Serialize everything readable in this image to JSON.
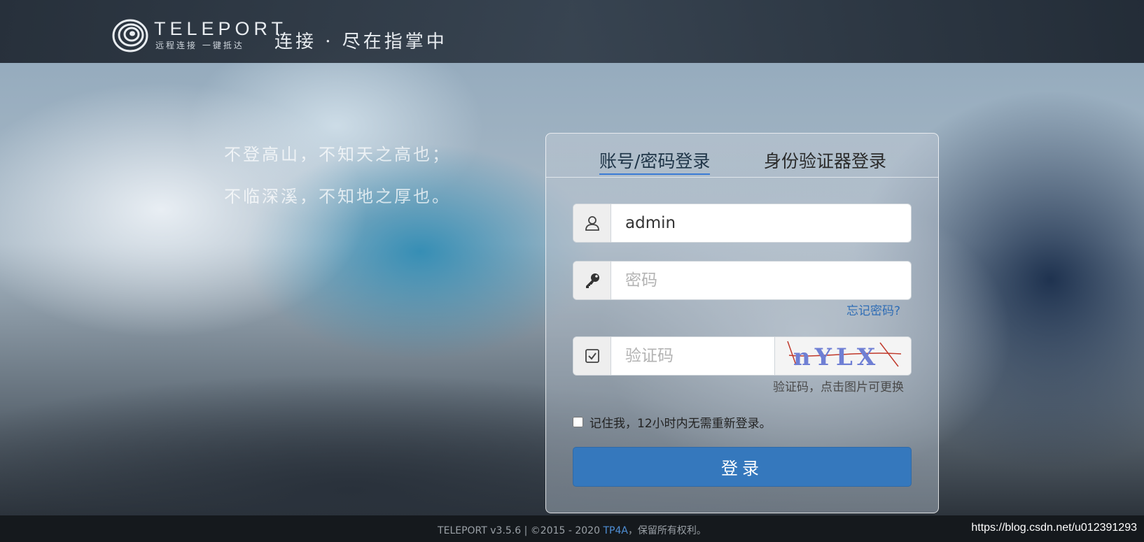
{
  "header": {
    "logo_word": "TELEPORT",
    "logo_sub": "远程连接 一键抵达",
    "slogan": "连接 · 尽在指掌中"
  },
  "poem": {
    "line1": "不登高山，不知天之高也；",
    "line2": "不临深溪，不知地之厚也。"
  },
  "login": {
    "tabs": [
      {
        "label": "账号/密码登录",
        "active": true
      },
      {
        "label": "身份验证器登录",
        "active": false
      }
    ],
    "username": {
      "value": "admin",
      "icon": "user-icon"
    },
    "password": {
      "value": "",
      "placeholder": "密码",
      "icon": "key-icon"
    },
    "forgot_label": "忘记密码?",
    "captcha": {
      "value": "",
      "placeholder": "验证码",
      "icon": "checkbox-icon",
      "image_text": "nYLX"
    },
    "captcha_hint": "验证码，点击图片可更换",
    "remember_label": "记住我，12小时内无需重新登录。",
    "remember_checked": false,
    "submit_label": "登录"
  },
  "footer": {
    "prefix": "TELEPORT v3.5.6 | ©2015 - 2020 ",
    "link": "TP4A",
    "suffix": "，保留所有权利。"
  },
  "watermark": "https://blog.csdn.net/u012391293",
  "colors": {
    "primary_button": "#3578bd",
    "link": "#2f6db5",
    "header_bg": "#1e2630"
  }
}
